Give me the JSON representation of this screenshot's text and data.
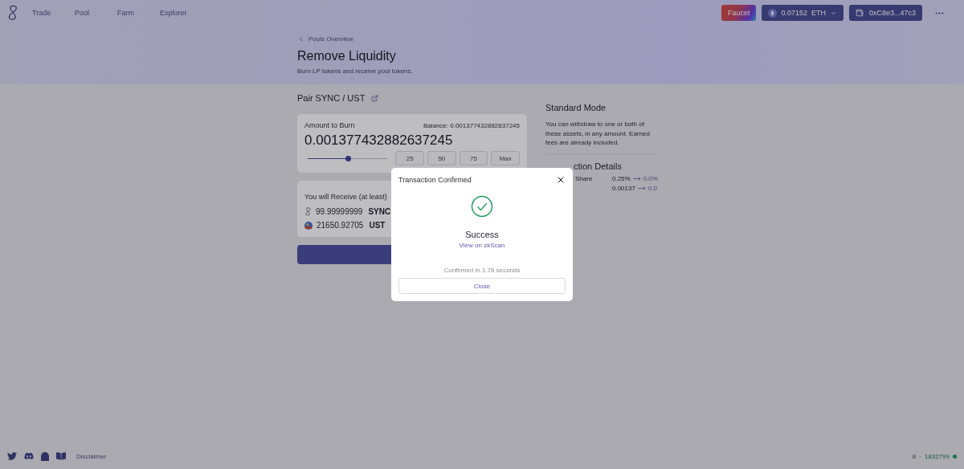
{
  "nav": {
    "items": [
      {
        "label": "Trade"
      },
      {
        "label": "Pool"
      },
      {
        "label": "Farm"
      },
      {
        "label": "Explorer"
      }
    ]
  },
  "header_actions": {
    "faucet": "Faucet",
    "balance": "0.07152",
    "currency": "ETH",
    "wallet": "0xC8e3...47c3"
  },
  "breadcrumb": "Pools Overview",
  "title": "Remove Liquidity",
  "subtitle": "Burn LP tokens and receive pool tokens.",
  "pair": "Pair SYNC / UST",
  "burn": {
    "label": "Amount to Burn",
    "balance": "Balance: 0.001377432882637245",
    "amount": "0.001377432882637245",
    "level": 0.5,
    "presets": [
      "25",
      "50",
      "75",
      "Max"
    ]
  },
  "receive": {
    "title": "You will Receive (at least)",
    "tokens": [
      {
        "kind": "sync",
        "amount": "99.99999999",
        "symbol": "SYNC"
      },
      {
        "kind": "ust",
        "amount": "21650.92705",
        "symbol": "UST"
      }
    ]
  },
  "info": {
    "title": "Standard Mode",
    "text": "You can withdraw to one or both of these assets, in any amount. Earned fees are already included.",
    "details_title": "ction Details",
    "rows": [
      {
        "label": "Share",
        "from": "0.25%",
        "to": "0.0%"
      },
      {
        "from": "0.00137",
        "to": "0.0"
      }
    ]
  },
  "modal": {
    "title": "Transaction Confirmed",
    "status": "Success",
    "link": "View on zkScan",
    "time": "Confirmed in 1.78 seconds",
    "button": "Close"
  },
  "footer": {
    "link": "Disclaimer",
    "network": "8",
    "separator": "·",
    "block": "1832799"
  }
}
